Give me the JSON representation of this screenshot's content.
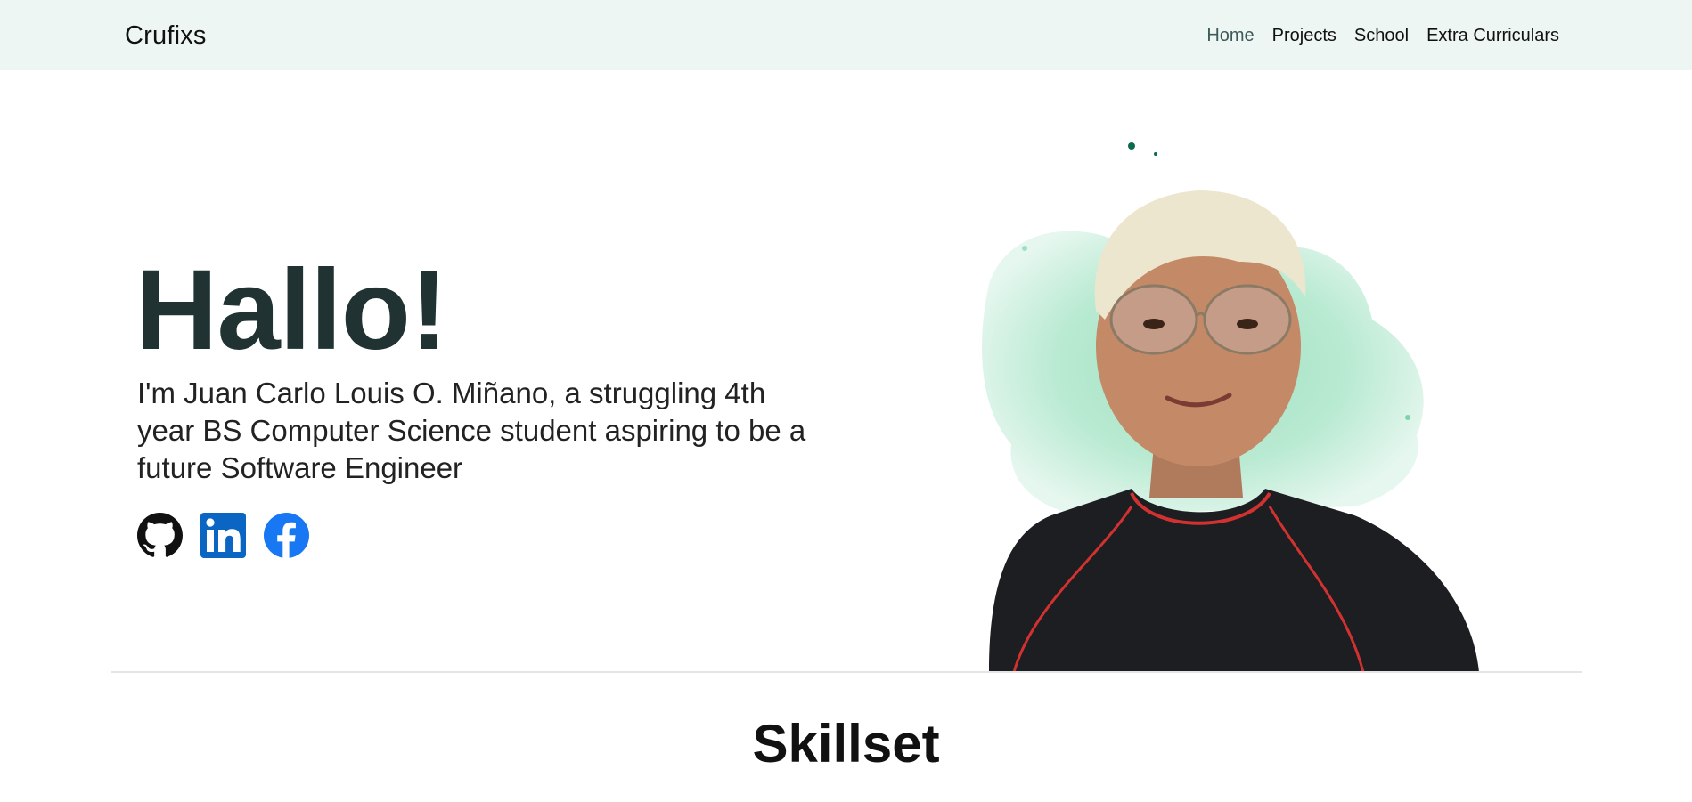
{
  "nav": {
    "brand": "Crufixs",
    "links": [
      {
        "label": "Home",
        "active": true
      },
      {
        "label": "Projects",
        "active": false
      },
      {
        "label": "School",
        "active": false
      },
      {
        "label": "Extra Curriculars",
        "active": false
      }
    ]
  },
  "hero": {
    "title": "Hallo!",
    "subtitle": "I'm Juan Carlo Louis O. Miñano, a struggling 4th year BS Computer Science student aspiring to be a future Software Engineer",
    "socials": [
      {
        "name": "GitHub",
        "icon": "github-icon",
        "color": "#111111"
      },
      {
        "name": "LinkedIn",
        "icon": "linkedin-icon",
        "color": "#0a66c2"
      },
      {
        "name": "Facebook",
        "icon": "facebook-icon",
        "color": "#1877f2"
      }
    ]
  },
  "skills": {
    "title": "Skillset"
  },
  "colors": {
    "navbar_bg": "#eef6f4",
    "accent_green": "#7fd3a8",
    "title_color": "#203232"
  }
}
